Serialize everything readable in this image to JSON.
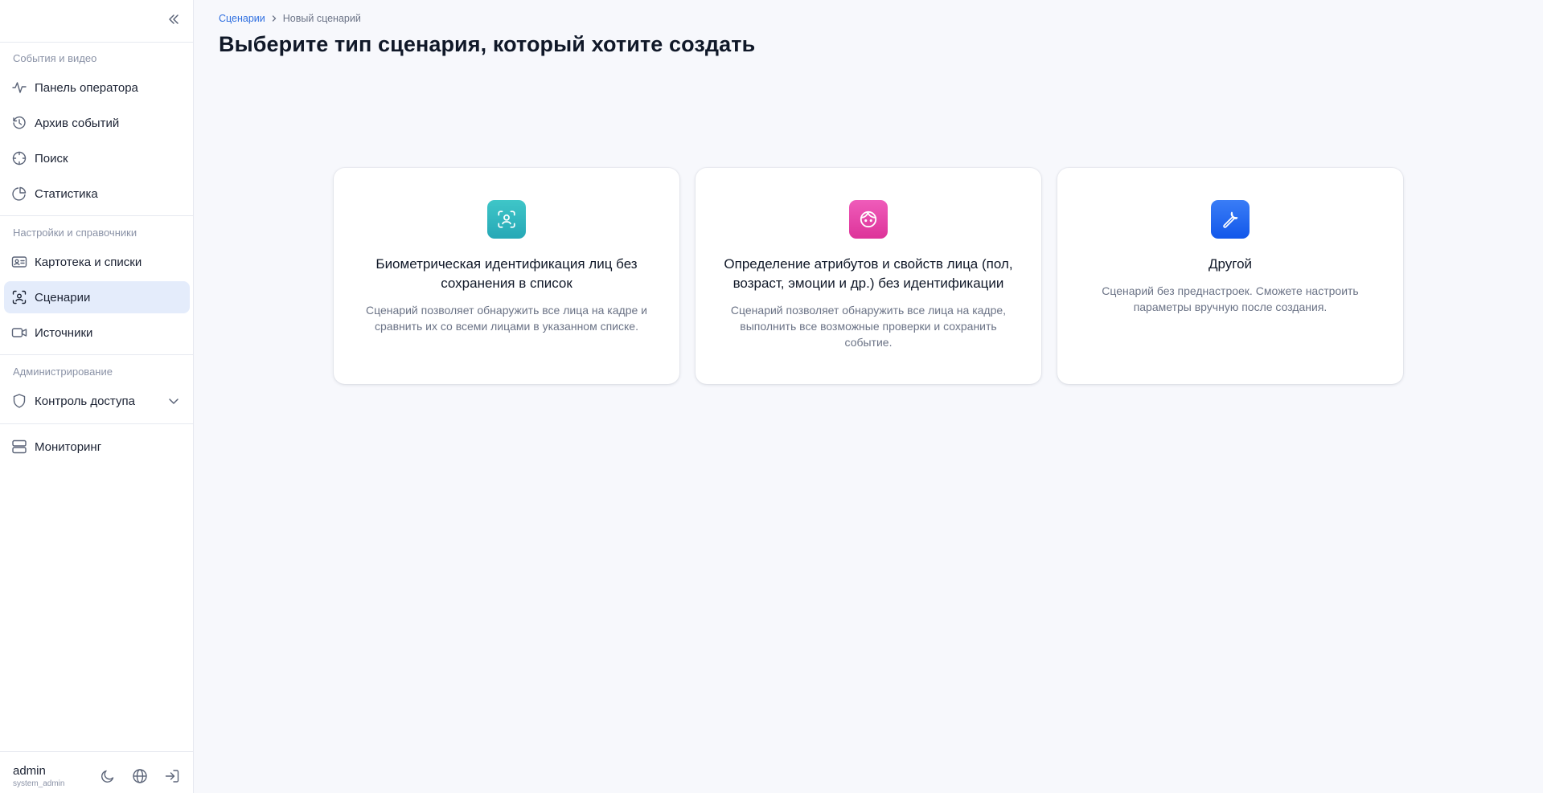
{
  "sidebar": {
    "sections": [
      {
        "label": "События и видео"
      },
      {
        "label": "Настройки и справочники"
      },
      {
        "label": "Администрирование"
      }
    ],
    "items": [
      {
        "label": "Панель оператора",
        "icon": "activity-icon"
      },
      {
        "label": "Архив событий",
        "icon": "history-icon"
      },
      {
        "label": "Поиск",
        "icon": "crosshair-icon"
      },
      {
        "label": "Статистика",
        "icon": "pie-chart-icon"
      },
      {
        "label": "Картотека и списки",
        "icon": "id-card-icon"
      },
      {
        "label": "Сценарии",
        "icon": "face-scan-icon",
        "active": true
      },
      {
        "label": "Источники",
        "icon": "video-camera-icon"
      },
      {
        "label": "Контроль доступа",
        "icon": "shield-icon"
      },
      {
        "label": "Мониторинг",
        "icon": "server-icon"
      }
    ],
    "user": {
      "name": "admin",
      "role": "system_admin"
    }
  },
  "breadcrumb": {
    "parent": "Сценарии",
    "current": "Новый сценарий"
  },
  "page_title": "Выберите тип сценария, который хотите создать",
  "cards": [
    {
      "title": "Биометрическая идентификация лиц без сохранения в список",
      "description": "Сценарий позволяет обнаружить все лица на кадре и сравнить их со всеми лицами в указанном списке.",
      "icon": "face-scan-icon",
      "color": "#2fb8bf"
    },
    {
      "title": "Определение атрибутов и свойств лица (пол, возраст, эмоции и др.) без идентификации",
      "description": "Сценарий позволяет обнаружить все лица на кадре, выполнить все возможные проверки и сохранить событие.",
      "icon": "face-icon",
      "color": "#e541a6"
    },
    {
      "title": "Другой",
      "description": "Сценарий без преднастроек. Сможете настроить параметры вручную после создания.",
      "icon": "wrench-icon",
      "color": "#1f63f2"
    }
  ],
  "colors": {
    "accent": "#2f6fe0",
    "active_bg": "#e4ecfb",
    "background": "#f7f8fc"
  }
}
